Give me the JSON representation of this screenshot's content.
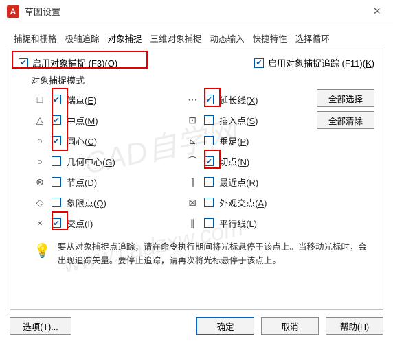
{
  "window": {
    "app_badge": "A",
    "title": "草图设置"
  },
  "tabs": [
    "捕捉和栅格",
    "极轴追踪",
    "对象捕捉",
    "三维对象捕捉",
    "动态输入",
    "快捷特性",
    "选择循环"
  ],
  "active_tab": 2,
  "enable_osnap": {
    "checked": true,
    "label": "启用对象捕捉  (F3)(",
    "accel": "O",
    "tail": ")"
  },
  "enable_track": {
    "checked": true,
    "label": "启用对象捕捉追踪 (F11)(",
    "accel": "K",
    "tail": ")"
  },
  "modes_label": "对象捕捉模式",
  "left_options": [
    {
      "sym": "□",
      "checked": true,
      "label": "端点(",
      "accel": "E",
      "tail": ")"
    },
    {
      "sym": "△",
      "checked": true,
      "label": "中点(",
      "accel": "M",
      "tail": ")"
    },
    {
      "sym": "○",
      "checked": true,
      "label": "圆心(",
      "accel": "C",
      "tail": ")"
    },
    {
      "sym": "○",
      "checked": false,
      "label": "几何中心(",
      "accel": "G",
      "tail": ")"
    },
    {
      "sym": "⊗",
      "checked": false,
      "label": "节点(",
      "accel": "D",
      "tail": ")"
    },
    {
      "sym": "◇",
      "checked": false,
      "label": "象限点(",
      "accel": "Q",
      "tail": ")"
    },
    {
      "sym": "×",
      "checked": true,
      "label": "交点(",
      "accel": "I",
      "tail": ")"
    }
  ],
  "right_options": [
    {
      "sym": "⋯",
      "checked": true,
      "label": "延长线(",
      "accel": "X",
      "tail": ")"
    },
    {
      "sym": "⊡",
      "checked": false,
      "label": "插入点(",
      "accel": "S",
      "tail": ")"
    },
    {
      "sym": "⊾",
      "checked": false,
      "label": "垂足(",
      "accel": "P",
      "tail": ")"
    },
    {
      "sym": "⌒",
      "checked": true,
      "label": "切点(",
      "accel": "N",
      "tail": ")"
    },
    {
      "sym": "⌉",
      "checked": false,
      "label": "最近点(",
      "accel": "R",
      "tail": ")"
    },
    {
      "sym": "⊠",
      "checked": false,
      "label": "外观交点(",
      "accel": "A",
      "tail": ")"
    },
    {
      "sym": "∥",
      "checked": false,
      "label": "平行线(",
      "accel": "L",
      "tail": ")"
    }
  ],
  "side_buttons": {
    "select_all": "全部选择",
    "clear_all": "全部清除"
  },
  "hint_text": "要从对象捕捉点追踪，请在命令执行期间将光标悬停于该点上。当移动光标时，会出现追踪矢量。要停止追踪，请再次将光标悬停于该点上。",
  "footer": {
    "options": "选项(T)...",
    "ok": "确定",
    "cancel": "取消",
    "help": "帮助(H)"
  },
  "watermark": "CAD自学网\nwww.cad zxw.com"
}
